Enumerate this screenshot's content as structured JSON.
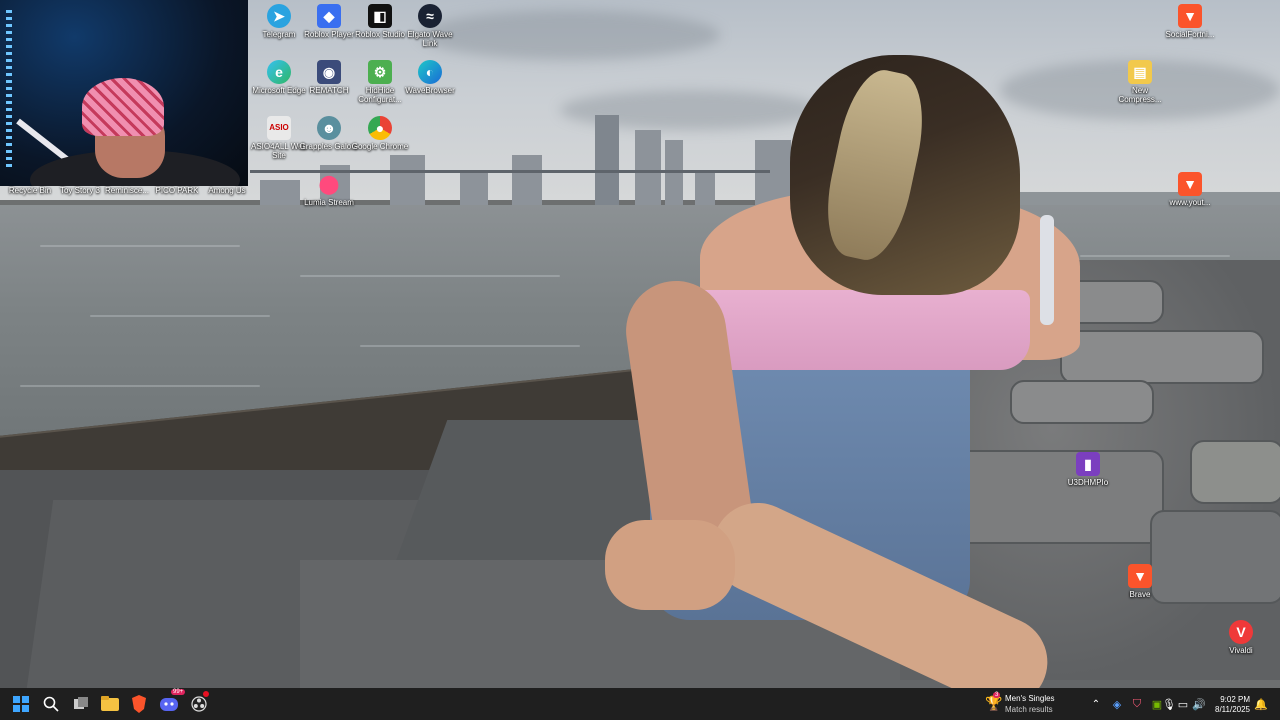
{
  "desktop": {
    "icons": [
      {
        "key": "recycle_bin",
        "label": "Recycle Bin"
      },
      {
        "key": "toy_story",
        "label": "Toy Story 3"
      },
      {
        "key": "reminisce",
        "label": "Reminisce..."
      },
      {
        "key": "pico_park",
        "label": "PICO PARK"
      },
      {
        "key": "among_us",
        "label": "Among Us"
      },
      {
        "key": "telegram",
        "label": "Telegram"
      },
      {
        "key": "roblox_player",
        "label": "Roblox Player"
      },
      {
        "key": "roblox_studio",
        "label": "Roblox Studio"
      },
      {
        "key": "elgato_wave_link",
        "label": "Elgato Wave Link"
      },
      {
        "key": "microsoft_edge",
        "label": "Microsoft Edge"
      },
      {
        "key": "rematch",
        "label": "REMATCH"
      },
      {
        "key": "hidhide",
        "label": "HidHide Configurat..."
      },
      {
        "key": "wavebrowser",
        "label": "WaveBrowser"
      },
      {
        "key": "asio4all",
        "label": "ASIO4ALL Web Site"
      },
      {
        "key": "grapples_galore",
        "label": "Grapples Galore"
      },
      {
        "key": "google_chrome",
        "label": "Google Chrome"
      },
      {
        "key": "lumia_stream",
        "label": "Lumia Stream"
      },
      {
        "key": "socialfortnite",
        "label": "SocialFortni..."
      },
      {
        "key": "new_compressed",
        "label": "New Compress..."
      },
      {
        "key": "youtube",
        "label": "www.yout..."
      },
      {
        "key": "u3dhmpio",
        "label": "U3DHMPIo"
      },
      {
        "key": "brave",
        "label": "Brave"
      },
      {
        "key": "vivaldi",
        "label": "Vivaldi"
      }
    ]
  },
  "taskbar": {
    "start": "start-icon",
    "search": "search-icon",
    "task_view": "task-view-icon",
    "apps": [
      {
        "name": "file-explorer-icon"
      },
      {
        "name": "brave-icon"
      },
      {
        "name": "discord-icon",
        "badge": "99+"
      },
      {
        "name": "obs-icon"
      }
    ],
    "notification_widget": {
      "badge": "3",
      "title": "Men's Singles",
      "subtitle": "Match results"
    },
    "tray_icons": [
      "chevron-up-icon",
      "network-app-icon",
      "shield-icon",
      "gpu-icon",
      "microphone-icon",
      "display-icon",
      "volume-icon"
    ],
    "time": "9:02 PM",
    "date": "8/11/2025",
    "notification_icon": "bell-icon"
  },
  "colors": {
    "taskbar_bg": "#1f1f1f",
    "start_blue": "#3ea6ff",
    "brave_orange": "#fb542b",
    "discord_purple": "#5865f2"
  }
}
